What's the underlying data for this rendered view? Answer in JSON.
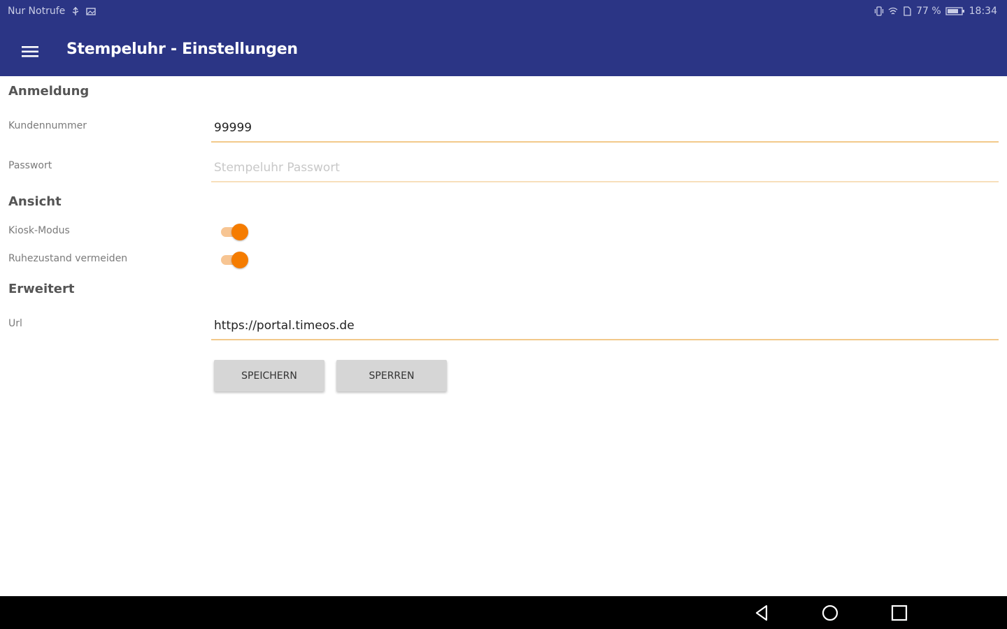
{
  "status_bar": {
    "carrier": "Nur Notrufe",
    "battery_percent": "77 %",
    "time": "18:34",
    "icons": [
      "usb-icon",
      "image-icon",
      "vibrate-icon",
      "wifi-icon",
      "sim-icon",
      "battery-icon"
    ]
  },
  "appbar": {
    "title": "Stempeluhr - Einstellungen",
    "background": "#2b3585"
  },
  "sections": {
    "login": {
      "title": "Anmeldung",
      "customer_number_label": "Kundennummer",
      "customer_number_value": "99999",
      "password_label": "Passwort",
      "password_placeholder": "Stempeluhr Passwort",
      "password_value": ""
    },
    "view": {
      "title": "Ansicht",
      "kiosk_label": "Kiosk-Modus",
      "kiosk_on": true,
      "sleep_label": "Ruhezustand vermeiden",
      "sleep_on": true
    },
    "advanced": {
      "title": "Erweitert",
      "url_label": "Url",
      "url_value": "https://portal.timeos.de"
    }
  },
  "buttons": {
    "save": "SPEICHERN",
    "lock": "SPERREN"
  },
  "accent_color": "#f57c00",
  "nav_bar": {
    "icons": [
      "back-icon",
      "home-icon",
      "recents-icon"
    ]
  }
}
